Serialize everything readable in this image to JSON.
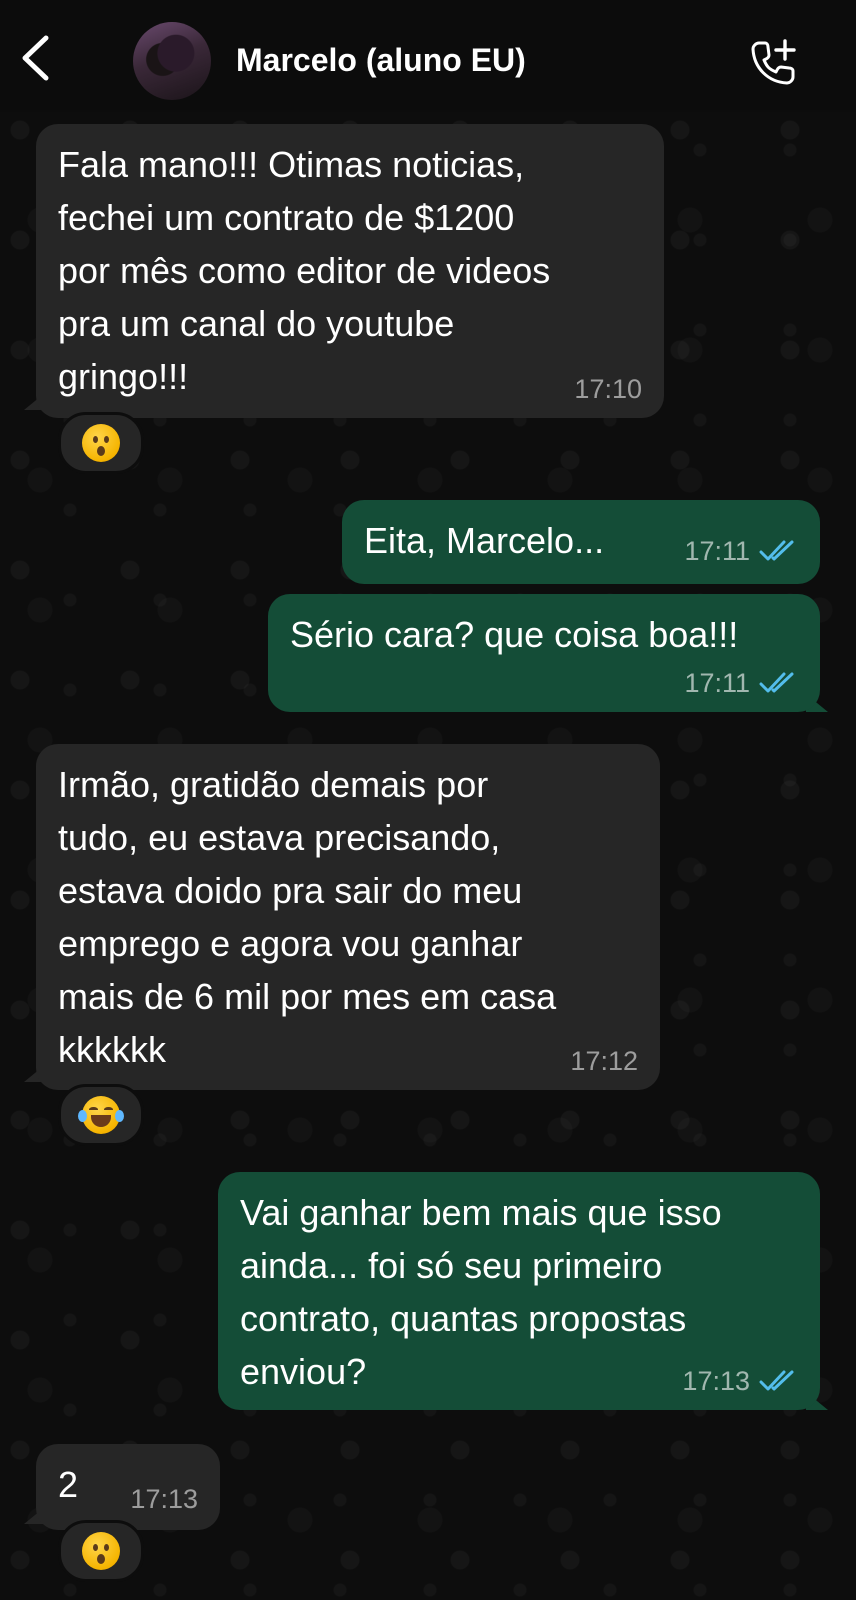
{
  "header": {
    "contact_name": "Marcelo (aluno EU)",
    "back_icon": "chevron-left-icon",
    "call_icon": "phone-add-icon"
  },
  "colors": {
    "incoming_bubble": "#262626",
    "outgoing_bubble": "#144d37",
    "read_ticks": "#53bdeb",
    "background": "#0d0d0d"
  },
  "messages": [
    {
      "direction": "incoming",
      "lines": [
        "Fala mano!!! Otimas noticias,",
        "fechei um contrato de $1200",
        "por mês como editor de videos",
        "pra um canal do youtube",
        "gringo!!!"
      ],
      "time": "17:10",
      "reaction": "hushed-face"
    },
    {
      "direction": "outgoing",
      "lines": [
        "Eita, Marcelo..."
      ],
      "time": "17:11",
      "status": "read"
    },
    {
      "direction": "outgoing",
      "lines": [
        "Sério cara? que coisa boa!!!"
      ],
      "time": "17:11",
      "status": "read"
    },
    {
      "direction": "incoming",
      "lines": [
        "Irmão, gratidão demais por",
        "tudo, eu estava precisando,",
        "estava doido pra sair do meu",
        "emprego e agora vou ganhar",
        "mais de 6 mil por mes em casa",
        "kkkkkk"
      ],
      "time": "17:12",
      "reaction": "face-with-tears-of-joy"
    },
    {
      "direction": "outgoing",
      "lines": [
        "Vai ganhar bem mais que isso",
        "ainda... foi só seu primeiro",
        "contrato, quantas propostas",
        "enviou?"
      ],
      "time": "17:13",
      "status": "read"
    },
    {
      "direction": "incoming",
      "lines": [
        "2"
      ],
      "time": "17:13",
      "reaction": "hushed-face"
    }
  ]
}
